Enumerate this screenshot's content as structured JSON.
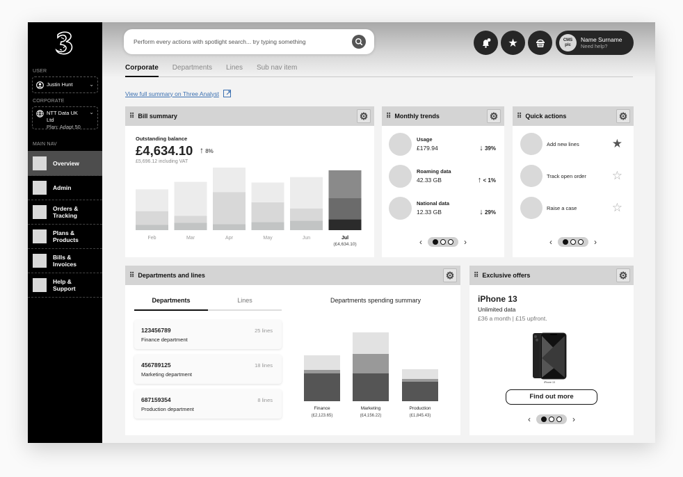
{
  "sidebar": {
    "logo": "three-logo",
    "user_label": "USER",
    "user_name": "Justin Hunt",
    "corporate_label": "CORPORATE",
    "corporate_name": "NTT Data UK Ltd",
    "corporate_plan": "Plan: Adapt 50",
    "main_nav_label": "MAIN NAV",
    "items": [
      {
        "label": "Overview",
        "active": true
      },
      {
        "label": "Admin"
      },
      {
        "label": "Orders &\nTracking"
      },
      {
        "label": "Plans &\nProducts"
      },
      {
        "label": "Bills &\nInvoices"
      },
      {
        "label": "Help &\nSupport"
      }
    ]
  },
  "header": {
    "search_placeholder": "Perform every actions with spotlight search... try typing something",
    "icons": [
      "notification-bell-icon",
      "star-icon",
      "basket-icon"
    ],
    "profile": {
      "avatar": "CMS plc",
      "avatar_line1": "CMS",
      "avatar_line2": "plc",
      "name": "Name Surname",
      "help": "Need help?"
    }
  },
  "subnav": {
    "tabs": [
      {
        "label": "Corporate",
        "active": true
      },
      {
        "label": "Departments"
      },
      {
        "label": "Lines"
      },
      {
        "label": "Sub nav item"
      }
    ],
    "analyst_link": "View full summary on Three Analyst"
  },
  "bill_summary": {
    "title": "Bill summary",
    "balance_label": "Outstanding balance",
    "balance": "£4,634.10",
    "trend_arrow": "↑",
    "trend": "8%",
    "vat_note": "£5,696.12 including VAT",
    "chart_data": {
      "type": "bar",
      "stacked": true,
      "categories": [
        "Feb",
        "Mar",
        "Apr",
        "May",
        "Jun",
        "Jul"
      ],
      "highlight": {
        "category": "Jul",
        "label": "(£4,634.10)"
      },
      "series": [
        {
          "name": "segment-1",
          "values": [
            8,
            11,
            9,
            12,
            14,
            16
          ]
        },
        {
          "name": "segment-2",
          "values": [
            20,
            10,
            47,
            29,
            18,
            31
          ]
        },
        {
          "name": "segment-3",
          "values": [
            32,
            50,
            36,
            29,
            46,
            41
          ]
        }
      ],
      "ylim": [
        0,
        92
      ]
    }
  },
  "monthly_trends": {
    "title": "Monthly trends",
    "items": [
      {
        "label": "Usage",
        "value": "£179.94",
        "arrow": "↓",
        "change": "39%"
      },
      {
        "label": "Roaming data",
        "value": "42.33 GB",
        "arrow": "↑",
        "change": "< 1%"
      },
      {
        "label": "National data",
        "value": "12.33 GB",
        "arrow": "↓",
        "change": "29%"
      }
    ],
    "page": 1,
    "pages": 3
  },
  "quick_actions": {
    "title": "Quick actions",
    "items": [
      {
        "label": "Add new lines",
        "favourite": true
      },
      {
        "label": "Track open order",
        "favourite": false
      },
      {
        "label": "Raise a case",
        "favourite": false
      }
    ],
    "page": 1,
    "pages": 3
  },
  "departments": {
    "title": "Departments and lines",
    "tabs": [
      {
        "label": "Departments",
        "active": true
      },
      {
        "label": "Lines"
      }
    ],
    "items": [
      {
        "code": "123456789",
        "name": "Finance department",
        "lines": "25 lines"
      },
      {
        "code": "456789125",
        "name": "Marketing department",
        "lines": "18 lines"
      },
      {
        "code": "687159354",
        "name": "Production department",
        "lines": "8 lines"
      }
    ],
    "chart_data": {
      "type": "bar",
      "stacked": true,
      "title": "Departments spending summary",
      "categories": [
        "Finance",
        "Marketing",
        "Production"
      ],
      "category_values": [
        "(£2,123.65)",
        "(£4,156.22)",
        "(£1,845.43)"
      ],
      "series": [
        {
          "name": "segment-1",
          "values": [
            40,
            40,
            28
          ]
        },
        {
          "name": "segment-2",
          "values": [
            5,
            28,
            4
          ]
        },
        {
          "name": "segment-3",
          "values": [
            21,
            31,
            14
          ]
        }
      ],
      "ylim": [
        0,
        110
      ]
    }
  },
  "offers": {
    "title": "Exclusive offers",
    "product": "iPhone 13",
    "subtitle": "Unlimited data",
    "price": "£36 a month | £15 upfront.",
    "image_caption": "iPhone 13",
    "cta": "Find out more",
    "page": 1,
    "pages": 3
  },
  "colors": {
    "sidebar_bg": "#000000",
    "active_nav": "#4d4d4d",
    "link": "#3a6fb0",
    "card_header": "#d4d4d4"
  }
}
